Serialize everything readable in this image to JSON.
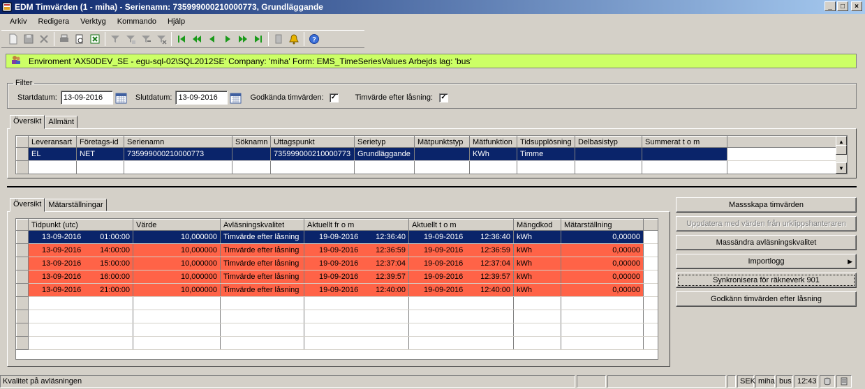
{
  "window": {
    "title": "EDM Timvärden (1 - miha) - Serienamn: 735999000210000773, Grundläggande",
    "buttons": [
      "_",
      "□",
      "×"
    ]
  },
  "menu": [
    "Arkiv",
    "Redigera",
    "Verktyg",
    "Kommando",
    "Hjälp"
  ],
  "env": {
    "text": "Enviroment 'AX50DEV_SE - egu-sql-02\\SQL2012SE' Company: 'miha' Form: EMS_TimeSeriesValues Arbejds lag: 'bus'",
    "color": "#ccff66"
  },
  "filter": {
    "legend": "Filter",
    "start_label": "Startdatum:",
    "start_value": "13-09-2016",
    "end_label": "Slutdatum:",
    "end_value": "13-09-2016",
    "approved_label": "Godkända timvärden:",
    "approved_checked": "✓",
    "after_lock_label": "Timvärde efter låsning:",
    "after_lock_checked": "✓"
  },
  "top_tabs": [
    "Översikt",
    "Allmänt"
  ],
  "top_grid": {
    "headers": [
      "Leveransart",
      "Företags-id",
      "Serienamn",
      "Söknamn",
      "Uttagspunkt",
      "Serietyp",
      "Mätpunktstyp",
      "Mätfunktion",
      "Tidsupplösning",
      "Delbasistyp",
      "Summerat t o m"
    ],
    "rows": [
      [
        "EL",
        "NET",
        "735999000210000773",
        "",
        "735999000210000773",
        "Grundläggande",
        "",
        "KWh",
        "Timme",
        "",
        ""
      ]
    ]
  },
  "bottom_tabs": [
    "Översikt",
    "Mätarställningar"
  ],
  "bottom_grid": {
    "headers": [
      "Tidpunkt (utc)",
      "Värde",
      "Avläsningskvalitet",
      "Aktuellt fr o m",
      "Aktuellt t o m",
      "Mängdkod",
      "Mätarställning"
    ],
    "rows": [
      {
        "date": "13-09-2016",
        "time": "01:00:00",
        "value": "10,000000",
        "quality": "Timvärde efter låsning",
        "from_date": "19-09-2016",
        "from_time": "12:36:40",
        "to_date": "19-09-2016",
        "to_time": "12:36:40",
        "unit": "kWh",
        "meter": "0,00000"
      },
      {
        "date": "13-09-2016",
        "time": "14:00:00",
        "value": "10,000000",
        "quality": "Timvärde efter låsning",
        "from_date": "19-09-2016",
        "from_time": "12:36:59",
        "to_date": "19-09-2016",
        "to_time": "12:36:59",
        "unit": "kWh",
        "meter": "0,00000"
      },
      {
        "date": "13-09-2016",
        "time": "15:00:00",
        "value": "10,000000",
        "quality": "Timvärde efter låsning",
        "from_date": "19-09-2016",
        "from_time": "12:37:04",
        "to_date": "19-09-2016",
        "to_time": "12:37:04",
        "unit": "kWh",
        "meter": "0,00000"
      },
      {
        "date": "13-09-2016",
        "time": "16:00:00",
        "value": "10,000000",
        "quality": "Timvärde efter låsning",
        "from_date": "19-09-2016",
        "from_time": "12:39:57",
        "to_date": "19-09-2016",
        "to_time": "12:39:57",
        "unit": "kWh",
        "meter": "0,00000"
      },
      {
        "date": "13-09-2016",
        "time": "21:00:00",
        "value": "10,000000",
        "quality": "Timvärde efter låsning",
        "from_date": "19-09-2016",
        "from_time": "12:40:00",
        "to_date": "19-09-2016",
        "to_time": "12:40:00",
        "unit": "kWh",
        "meter": "0,00000"
      }
    ],
    "selected_color": "#0a246a",
    "locked_color": "#ff6347"
  },
  "actions": {
    "mass_create": "Massskapa timvärden",
    "update_clipboard": "Uppdatera med värden från urklippshanteraren",
    "mass_change_quality": "Massändra avläsningskvalitet",
    "import_log": "Importlogg",
    "sync_counter": "Synkronisera för räkneverk 901",
    "approve_after_lock": "Godkänn timvärden efter låsning"
  },
  "status": {
    "message": "Kvalitet på avläsningen",
    "currency": "SEK",
    "company": "miha",
    "layer": "bus",
    "time": "12:43"
  }
}
